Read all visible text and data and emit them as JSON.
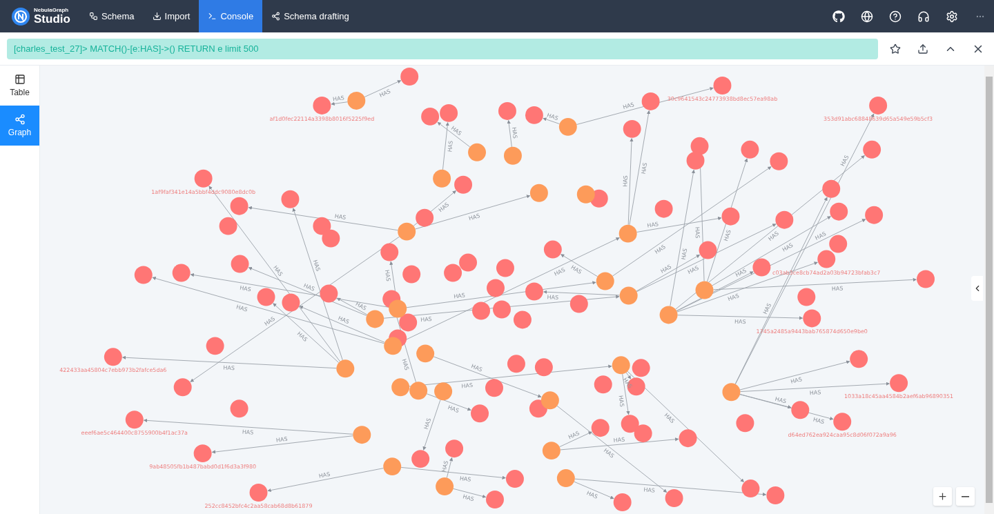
{
  "app": {
    "logo_small": "NebulaGraph",
    "logo_big": "Studio"
  },
  "nav": [
    {
      "label": "Schema",
      "selected": false
    },
    {
      "label": "Import",
      "selected": false
    },
    {
      "label": "Console",
      "selected": true
    },
    {
      "label": "Schema drafting",
      "selected": false
    }
  ],
  "query": {
    "value": "[charles_test_27]> MATCH()-[e:HAS]->() RETURN e limit 500"
  },
  "view_tabs": [
    {
      "label": "Table",
      "selected": false
    },
    {
      "label": "Graph",
      "selected": true
    }
  ],
  "graph": {
    "nodes": [
      {
        "label": "1af9faf341e14a5bbf4ddc9080e8dc0b",
        "color": "#ff7675"
      },
      {
        "label": "af1d0fec22114a3398b8016f5225f9ed",
        "color": "#ff7675"
      },
      {
        "label": "422433aa45804c7ebb973b2fafce5da6",
        "color": "#ff7675"
      },
      {
        "label": "eeef6ae5c464400c8755900b4f1ac37a",
        "color": "#ff7675"
      },
      {
        "label": "9ab48505fb1b487babd0d1f6d3a3f980",
        "color": "#ff7675"
      },
      {
        "label": "252cc8452bfc4c2aa58cab68d8b61879",
        "color": "#ff7675"
      },
      {
        "label": "30c9641543c24773938bd8ec57ea98ab",
        "color": "#ff7675"
      },
      {
        "label": "353d91abc68848639d65a549e59b5cf3",
        "color": "#ff7675"
      },
      {
        "label": "c03ab3ce8cb74ad2a03b94723bfab3c7",
        "color": "#ff7675"
      },
      {
        "label": "1745a2485a9443bab765874d650e9be0",
        "color": "#ff7675"
      },
      {
        "label": "1033a18c45aa4584b2aef6ab96890351",
        "color": "#ff7675"
      },
      {
        "label": "d64ed762ea924caa95c8d06f072a9a96",
        "color": "#ff7675"
      },
      {
        "color": "#ff7675"
      },
      {
        "color": "#ff7675"
      },
      {
        "color": "#ff7675"
      },
      {
        "color": "#ff7675"
      },
      {
        "color": "#ff7675"
      },
      {
        "color": "#ff7675"
      },
      {
        "color": "#ff7675"
      },
      {
        "color": "#ff7675"
      },
      {
        "color": "#ff7675"
      },
      {
        "color": "#ff7675"
      },
      {
        "color": "#ff7675"
      },
      {
        "color": "#ff7675"
      },
      {
        "color": "#ff7675"
      },
      {
        "color": "#ff7675"
      },
      {
        "color": "#ff7675"
      },
      {
        "color": "#ff7675"
      },
      {
        "color": "#ff7675"
      },
      {
        "color": "#ff7675"
      },
      {
        "color": "#ff7675"
      },
      {
        "color": "#ff7675"
      },
      {
        "color": "#ff7675"
      },
      {
        "color": "#ff7675"
      },
      {
        "color": "#ff7675"
      },
      {
        "color": "#ff7675"
      },
      {
        "color": "#ff7675"
      },
      {
        "color": "#ff7675"
      },
      {
        "color": "#ff7675"
      },
      {
        "color": "#ff7675"
      },
      {
        "color": "#ff7675"
      },
      {
        "color": "#ff7675"
      },
      {
        "color": "#ff7675"
      },
      {
        "color": "#ff7675"
      },
      {
        "color": "#ff7675"
      },
      {
        "color": "#ff7675"
      },
      {
        "color": "#ff7675"
      },
      {
        "color": "#ff7675"
      },
      {
        "color": "#ff7675"
      },
      {
        "color": "#ff7675"
      },
      {
        "color": "#ff7675"
      },
      {
        "color": "#ff7675"
      },
      {
        "color": "#ff7675"
      },
      {
        "color": "#ff7675"
      },
      {
        "color": "#ff7675"
      },
      {
        "color": "#ff7675"
      },
      {
        "color": "#ff7675"
      },
      {
        "color": "#ff7675"
      },
      {
        "color": "#ff7675"
      },
      {
        "color": "#ff7675"
      },
      {
        "color": "#ff7675"
      },
      {
        "color": "#ff7675"
      },
      {
        "color": "#ff7675"
      },
      {
        "color": "#ff7675"
      },
      {
        "color": "#ff7675"
      },
      {
        "color": "#ff7675"
      },
      {
        "color": "#ff7675"
      },
      {
        "color": "#ff7675"
      },
      {
        "color": "#ff7675"
      },
      {
        "color": "#ff7675"
      },
      {
        "color": "#ff7675"
      },
      {
        "color": "#ff7675"
      },
      {
        "color": "#ff7675"
      },
      {
        "color": "#ff7675"
      },
      {
        "color": "#ff7675"
      },
      {
        "color": "#ff7675"
      },
      {
        "color": "#ff7675"
      },
      {
        "color": "#ff7675"
      },
      {
        "color": "#ff7675"
      },
      {
        "color": "#ff7675"
      },
      {
        "color": "#ff7675"
      },
      {
        "color": "#ff7675"
      },
      {
        "color": "#ff7675"
      },
      {
        "color": "#ff7675"
      },
      {
        "color": "#ff7675"
      },
      {
        "color": "#ff7675"
      },
      {
        "color": "#ff7675"
      },
      {
        "color": "#ff7675"
      },
      {
        "color": "#ff7675"
      },
      {
        "color": "#ff7675"
      },
      {
        "color": "#fd9b5a"
      },
      {
        "color": "#fd9b5a"
      },
      {
        "color": "#fd9b5a"
      },
      {
        "color": "#fd9b5a"
      },
      {
        "color": "#fd9b5a"
      },
      {
        "color": "#fd9b5a"
      },
      {
        "color": "#fd9b5a"
      },
      {
        "color": "#fd9b5a"
      },
      {
        "color": "#fd9b5a"
      },
      {
        "color": "#fd9b5a"
      },
      {
        "color": "#fd9b5a"
      },
      {
        "color": "#fd9b5a"
      },
      {
        "color": "#fd9b5a"
      },
      {
        "color": "#fd9b5a"
      },
      {
        "color": "#fd9b5a"
      },
      {
        "color": "#fd9b5a"
      },
      {
        "color": "#fd9b5a"
      },
      {
        "color": "#fd9b5a"
      },
      {
        "color": "#fd9b5a"
      },
      {
        "color": "#fd9b5a"
      },
      {
        "color": "#fd9b5a"
      },
      {
        "color": "#fd9b5a"
      },
      {
        "color": "#fd9b5a"
      },
      {
        "color": "#fd9b5a"
      },
      {
        "color": "#fd9b5a"
      },
      {
        "color": "#fd9b5a"
      },
      {
        "color": "#fd9b5a"
      },
      {
        "color": "#fd9b5a"
      },
      {
        "color": "#fd9b5a"
      }
    ],
    "edges": [
      {
        "label": "HAS"
      },
      {
        "label": "HAS"
      },
      {
        "label": "HAS"
      },
      {
        "label": "HAS"
      },
      {
        "label": "HAS"
      },
      {
        "label": "HAS"
      },
      {
        "label": "HAS"
      },
      {
        "label": "HAS"
      },
      {
        "label": "HAS"
      },
      {
        "label": "HAS"
      },
      {
        "label": "HAS"
      },
      {
        "label": "HAS"
      },
      {
        "label": "HAS"
      },
      {
        "label": "HAS"
      },
      {
        "label": "HAS"
      },
      {
        "label": "HAS"
      },
      {
        "label": "HAS"
      },
      {
        "label": "HAS"
      },
      {
        "label": "HAS"
      },
      {
        "label": "HAS"
      },
      {
        "label": "HAS"
      },
      {
        "label": "HAS"
      },
      {
        "label": "HAS"
      },
      {
        "label": "HAS"
      },
      {
        "label": "HAS"
      },
      {
        "label": "HAS"
      },
      {
        "label": "HAS"
      },
      {
        "label": "HAS"
      },
      {
        "label": "HAS"
      },
      {
        "label": "HAS"
      },
      {
        "label": "HAS"
      },
      {
        "label": "HAS"
      },
      {
        "label": "HAS"
      },
      {
        "label": "HAS"
      },
      {
        "label": "HAS"
      },
      {
        "label": "HAS"
      },
      {
        "label": "HAS"
      },
      {
        "label": "HAS"
      },
      {
        "label": "HAS"
      },
      {
        "label": "HAS"
      },
      {
        "label": "HAS"
      },
      {
        "label": "HAS"
      },
      {
        "label": "HAS"
      },
      {
        "label": "HAS"
      },
      {
        "label": "HAS"
      },
      {
        "label": "HAS"
      },
      {
        "label": "HAS"
      },
      {
        "label": "HAS"
      },
      {
        "label": "HAS"
      },
      {
        "label": "HAS"
      },
      {
        "label": "HAS"
      },
      {
        "label": "HAS"
      },
      {
        "label": "HAS"
      },
      {
        "label": "HAS"
      },
      {
        "label": "HAS"
      },
      {
        "label": "HAS"
      },
      {
        "label": "HAS"
      },
      {
        "label": "HAS"
      },
      {
        "label": "HAS"
      },
      {
        "label": "HAS"
      },
      {
        "label": "HAS"
      },
      {
        "label": "HAS"
      },
      {
        "label": "HAS"
      },
      {
        "label": "HAS"
      },
      {
        "label": "HAS"
      },
      {
        "label": "HAS"
      },
      {
        "label": "HAS"
      }
    ]
  }
}
